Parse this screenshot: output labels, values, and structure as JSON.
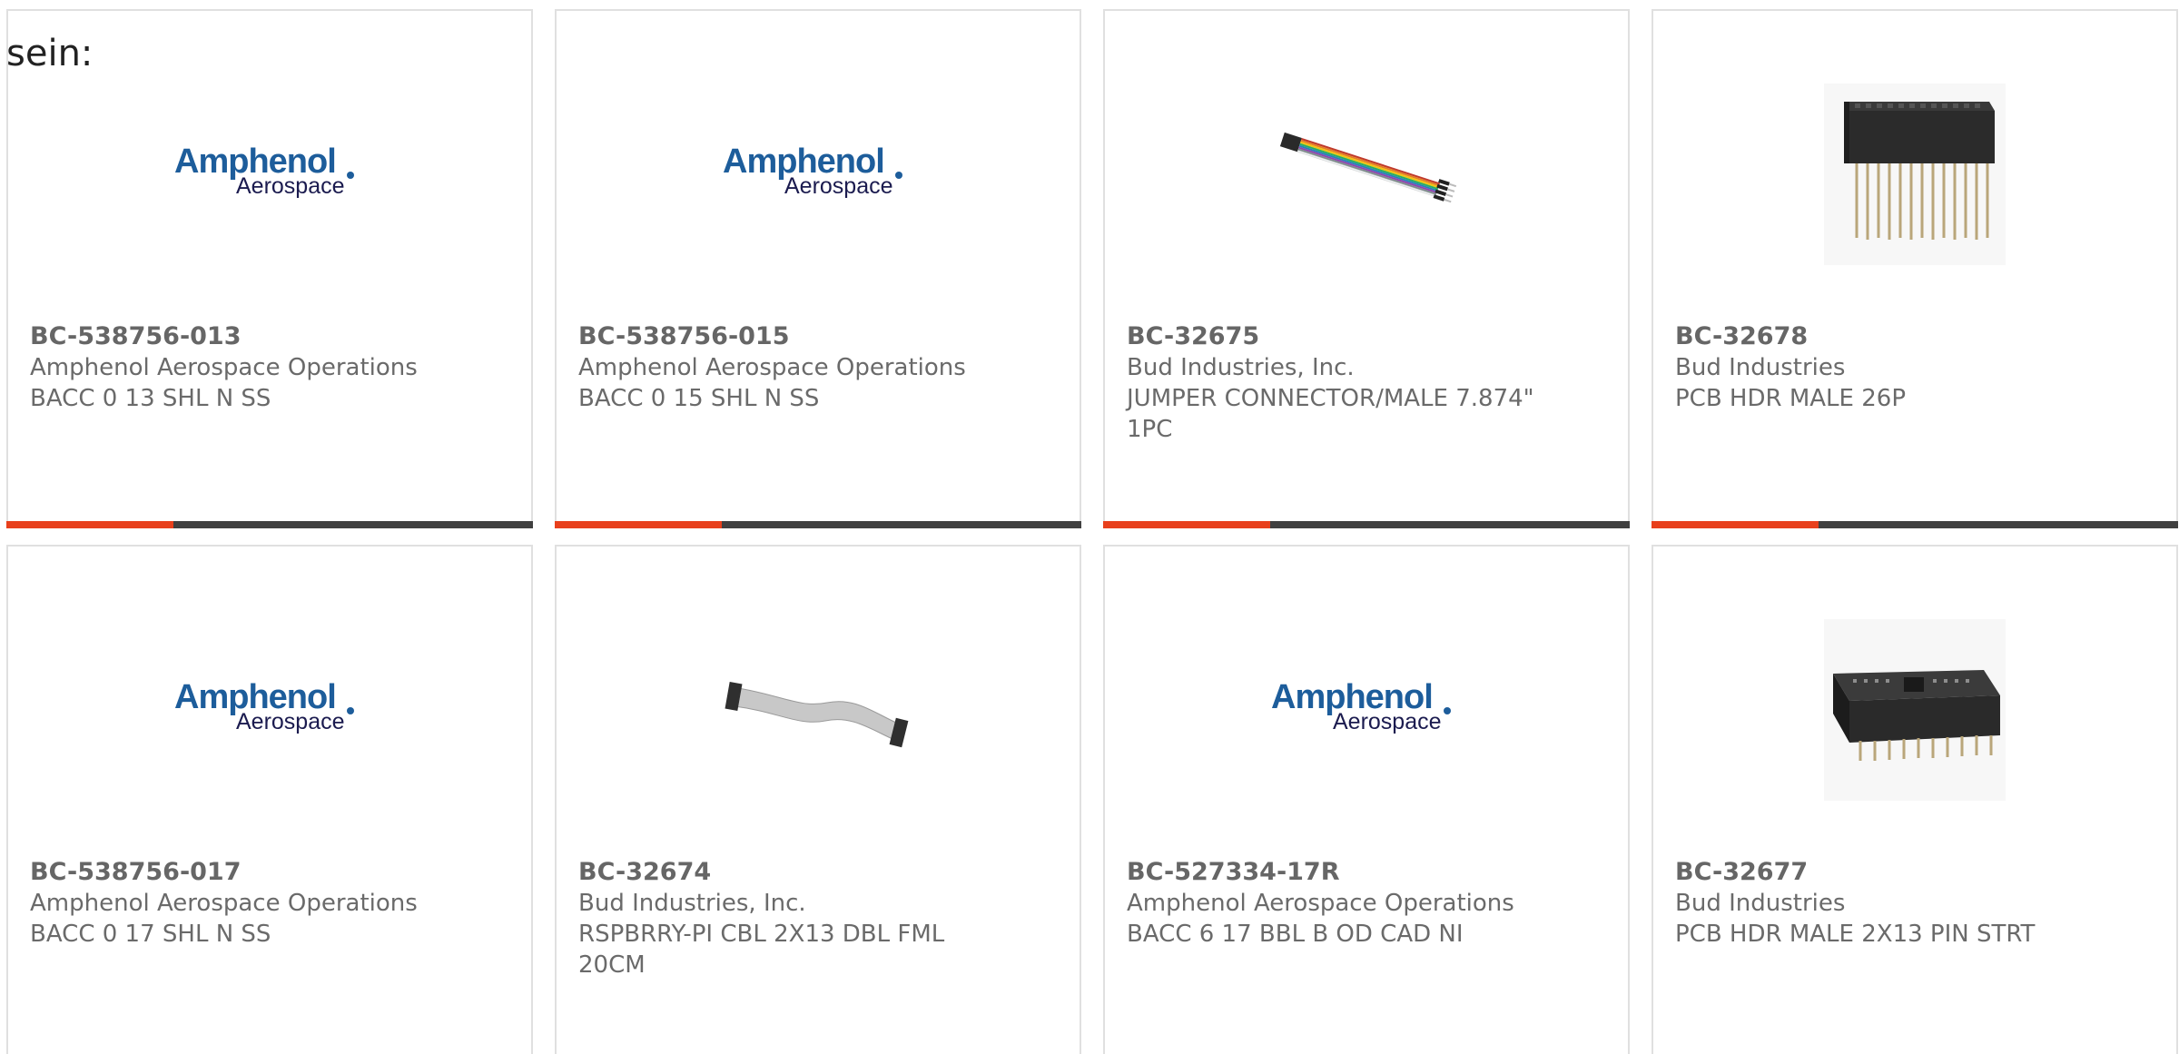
{
  "intro_text": "sein:",
  "colors": {
    "accent": "#e8401c",
    "bar_dark": "#404040",
    "brand_blue": "#1d5d9b",
    "text_gray": "#6a6a6a"
  },
  "logo": {
    "line1": "Amphenol",
    "line2": "Aerospace"
  },
  "products": [
    {
      "part_number": "BC-538756-013",
      "manufacturer": "Amphenol Aerospace Operations",
      "description": "BACC 0 13 SHL N SS",
      "image": "amphenol-logo"
    },
    {
      "part_number": "BC-538756-015",
      "manufacturer": "Amphenol Aerospace Operations",
      "description": "BACC 0 15 SHL N SS",
      "image": "amphenol-logo"
    },
    {
      "part_number": "BC-32675",
      "manufacturer": "Bud Industries, Inc.",
      "description": "JUMPER CONNECTOR/MALE 7.874\" 1PC",
      "image": "rainbow-jumper-cable"
    },
    {
      "part_number": "BC-32678",
      "manufacturer": "Bud Industries",
      "description": "PCB HDR MALE 26P",
      "image": "stacking-header"
    },
    {
      "part_number": "BC-538756-017",
      "manufacturer": "Amphenol Aerospace Operations",
      "description": "BACC 0 17 SHL N SS",
      "image": "amphenol-logo"
    },
    {
      "part_number": "BC-32674",
      "manufacturer": "Bud Industries, Inc.",
      "description": "RSPBRRY-PI CBL 2X13 DBL FML 20CM",
      "image": "ribbon-cable"
    },
    {
      "part_number": "BC-527334-17R",
      "manufacturer": "Amphenol Aerospace Operations",
      "description": "BACC 6 17 BBL B OD CAD NI",
      "image": "amphenol-logo"
    },
    {
      "part_number": "BC-32677",
      "manufacturer": "Bud Industries",
      "description": "PCB HDR MALE 2X13 PIN STRT",
      "image": "box-header"
    }
  ]
}
